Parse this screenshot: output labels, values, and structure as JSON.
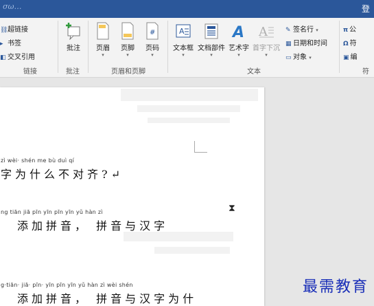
{
  "titlebar": {
    "tail_text": "σω…",
    "login": "登"
  },
  "ribbon": {
    "links_group": {
      "label": "链接",
      "items": [
        {
          "icon": "hyperlink-icon",
          "label": "超链接"
        },
        {
          "icon": "bookmark-icon",
          "label": "书签"
        },
        {
          "icon": "cross-reference-icon",
          "label": "交叉引用"
        }
      ]
    },
    "comments_group": {
      "label": "批注",
      "button": "批注"
    },
    "header_footer_group": {
      "label": "页眉和页脚",
      "buttons": [
        "页眉",
        "页脚",
        "页码"
      ]
    },
    "text_group": {
      "label": "文本",
      "buttons": [
        "文本框",
        "文档部件",
        "艺术字",
        "首字下沉"
      ],
      "small": [
        "签名行",
        "日期和时间",
        "对象"
      ]
    },
    "symbols_group": {
      "label": "符",
      "items": [
        "公",
        "符",
        "编"
      ]
    }
  },
  "document": {
    "lines": [
      {
        "pinyin": "zì wèi· shén me bù duì qí",
        "hanzi": "字为什么不对齐?↵"
      },
      {
        "pinyin": "ng tiān  jiā  pīn  yīn        pīn  yīn  yǔ  hàn  zì",
        "hanzi": "添加拼音，  拼音与汉字"
      },
      {
        "pinyin": "g·tiān· jiā· pīn· yīn      pīn yīn yǔ hàn zì wèi shén",
        "hanzi": "添加拼音，  拼音与汉字为什"
      }
    ]
  },
  "watermark": "最需教育"
}
